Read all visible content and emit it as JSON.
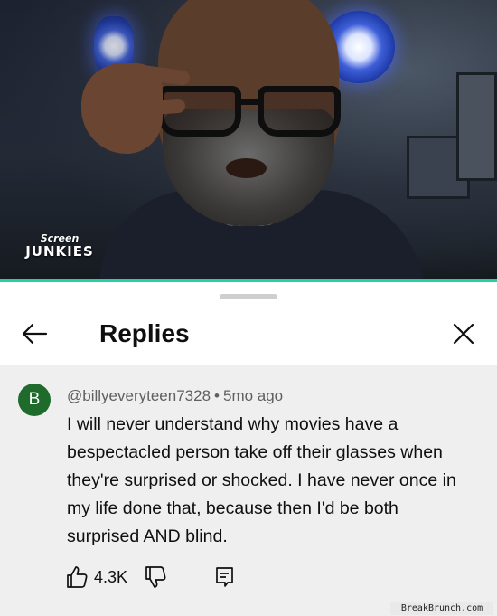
{
  "video": {
    "logo_line1": "Screen",
    "logo_line2": "JUNKIES",
    "progress_fraction": 1.0,
    "progress_color": "#22d3a0"
  },
  "header": {
    "back_icon": "arrow-left-icon",
    "title": "Replies",
    "close_icon": "close-icon"
  },
  "comment": {
    "avatar_letter": "B",
    "avatar_color": "#1e6b2c",
    "author": "@billyeveryteen7328",
    "separator": "•",
    "age": "5mo ago",
    "text": "I will never understand why movies have a bespectacled person take off their glasses when they're surprised or shocked. I have never once in my life done that, because then I'd be both surprised AND blind.",
    "like_icon": "thumbs-up-icon",
    "like_count": "4.3K",
    "dislike_icon": "thumbs-down-icon",
    "reply_icon": "reply-icon"
  },
  "watermark": {
    "text": "BreakBrunch.com"
  }
}
